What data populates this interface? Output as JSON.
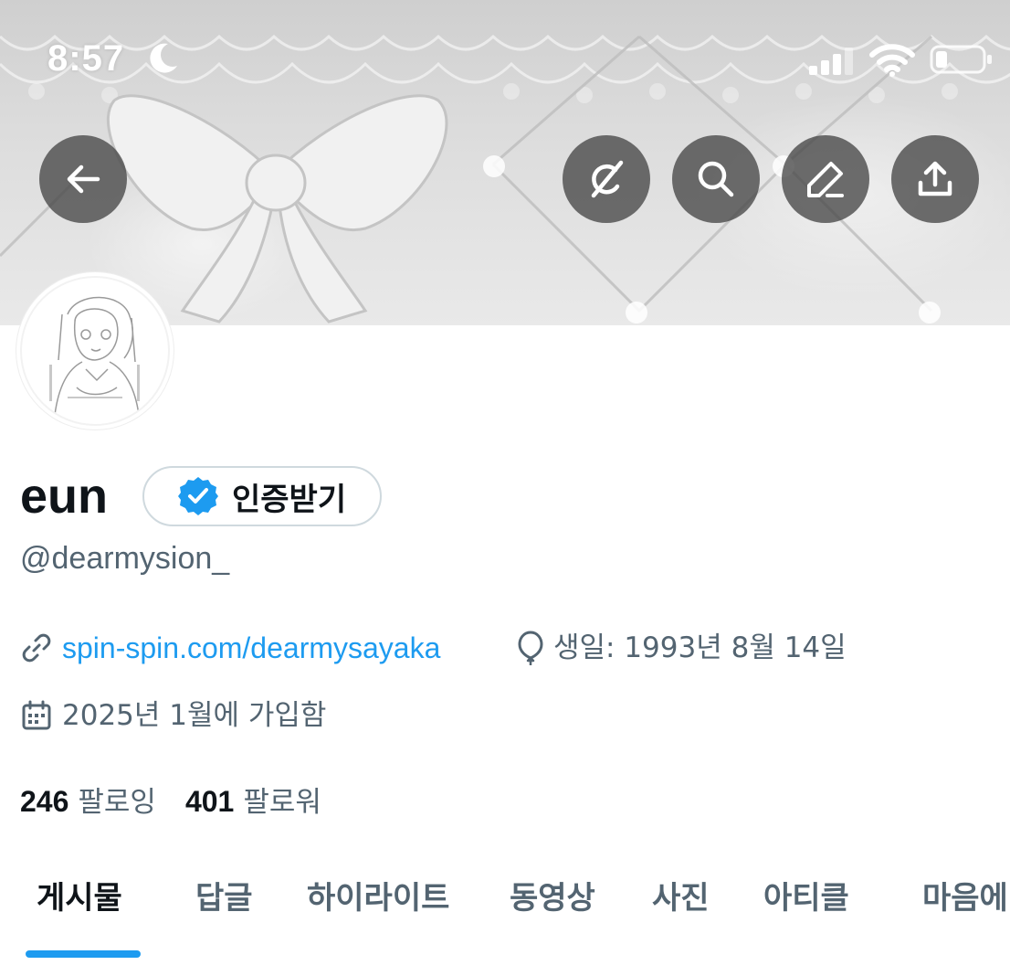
{
  "status_bar": {
    "time": "8:57"
  },
  "header_buttons": {
    "back": "back",
    "grok": "grok",
    "search": "search",
    "edit": "edit",
    "share": "share"
  },
  "profile": {
    "display_name": "eun",
    "verify_label": "인증받기",
    "handle": "@dearmysion_",
    "website": "spin-spin.com/dearmysayaka",
    "birthday": "생일: 1993년 8월 14일",
    "joined": "2025년 1월에 가입함"
  },
  "stats": {
    "following_count": "246",
    "following_label": "팔로잉",
    "followers_count": "401",
    "followers_label": "팔로워"
  },
  "tabs": [
    {
      "label": "게시물",
      "active": true
    },
    {
      "label": "답글",
      "active": false
    },
    {
      "label": "하이라이트",
      "active": false
    },
    {
      "label": "동영상",
      "active": false
    },
    {
      "label": "사진",
      "active": false
    },
    {
      "label": "아티클",
      "active": false
    },
    {
      "label": "마음에",
      "active": false
    }
  ],
  "colors": {
    "accent": "#1d9bf0",
    "text_primary": "#0f1419",
    "text_secondary": "#536471",
    "button_overlay": "#464646"
  },
  "icons": [
    "moon-icon",
    "cellular-signal-icon",
    "wifi-icon",
    "battery-icon",
    "back-arrow-icon",
    "grok-icon",
    "search-icon",
    "edit-icon",
    "share-icon",
    "verified-badge-icon",
    "link-icon",
    "balloon-icon",
    "calendar-icon"
  ]
}
